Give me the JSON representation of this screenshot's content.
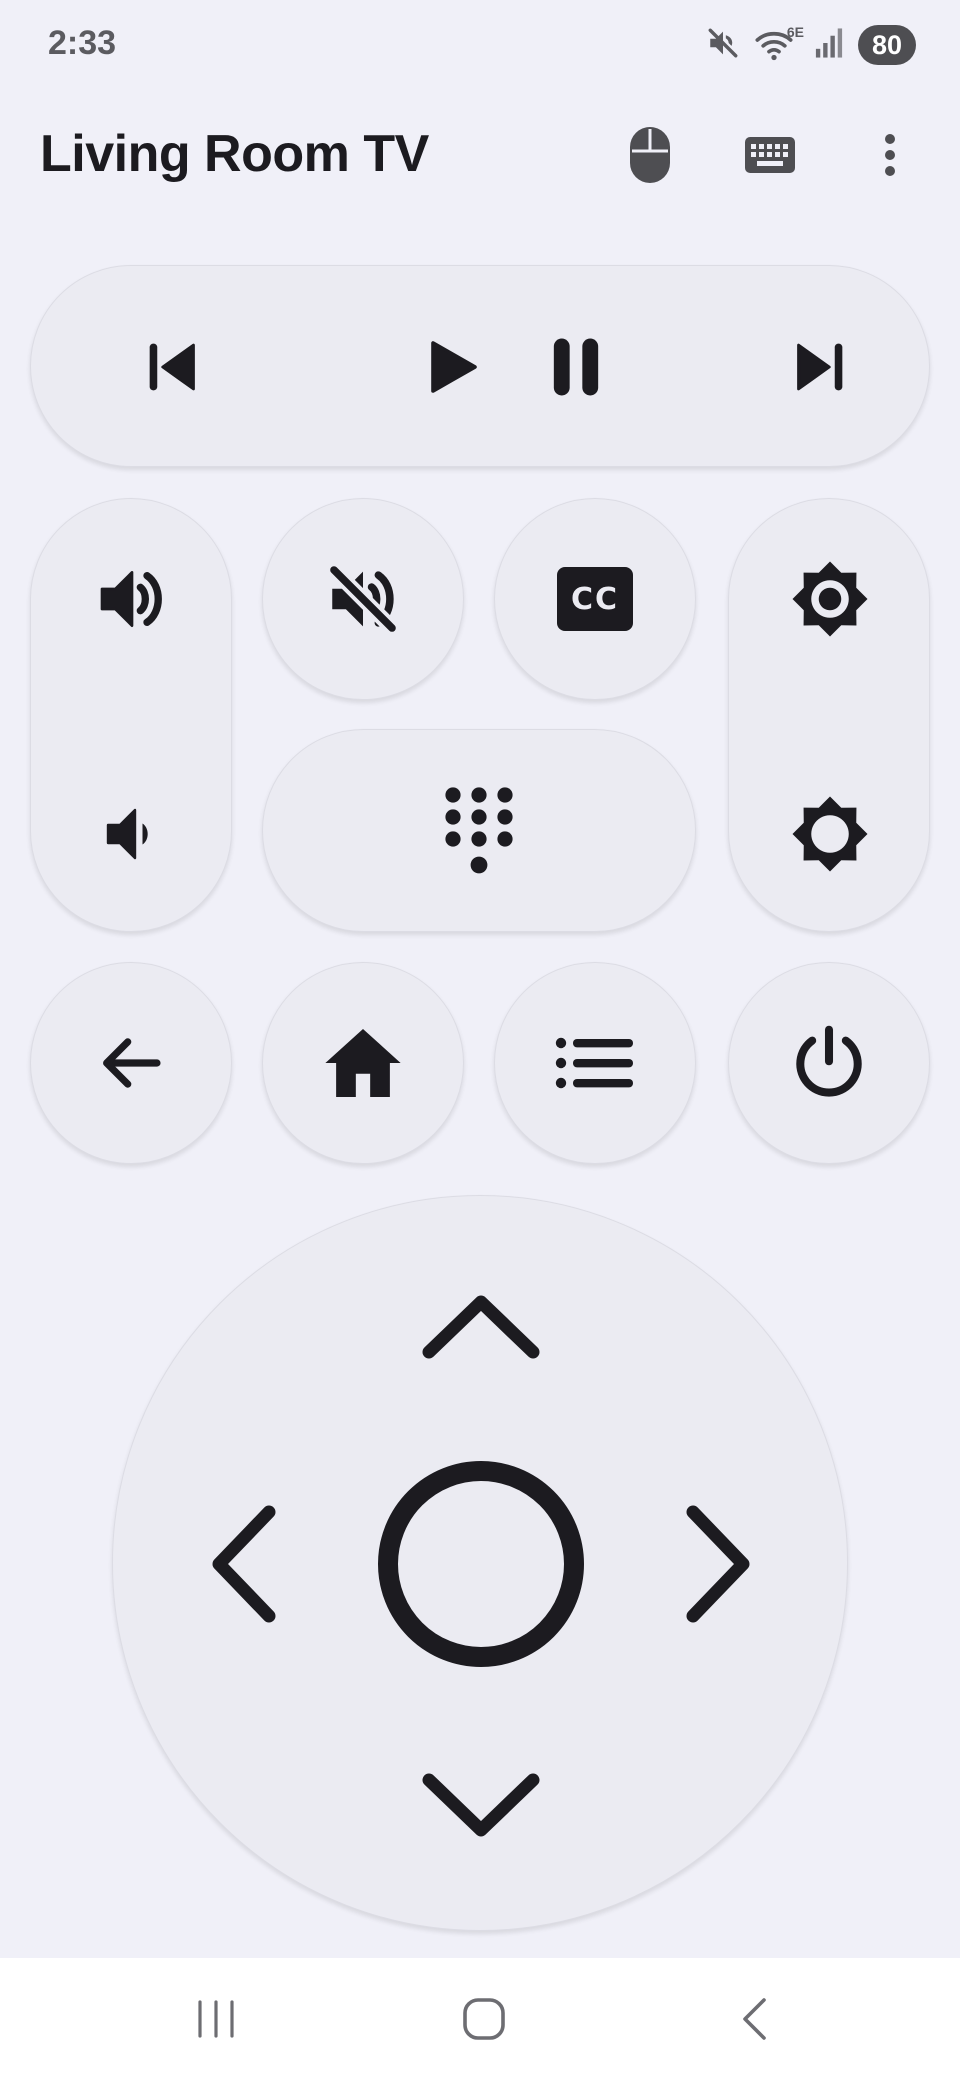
{
  "status_bar": {
    "time": "2:33",
    "battery_level": "80",
    "network_label": "6E",
    "icons": [
      "mute-icon",
      "wifi-icon",
      "signal-icon",
      "battery-icon"
    ]
  },
  "app_bar": {
    "title": "Living Room TV",
    "actions": [
      "mouse-icon",
      "keyboard-icon",
      "more-vert-icon"
    ]
  },
  "remote": {
    "media_row": [
      "skip-previous-icon",
      "play-icon",
      "pause-icon",
      "skip-next-icon"
    ],
    "volume": [
      "volume-up-icon",
      "volume-down-icon"
    ],
    "mute": "volume-off-icon",
    "captions": "closed-caption-icon",
    "captions_label": "CC",
    "numpad": "dialpad-icon",
    "brightness": [
      "brightness-up-icon",
      "brightness-down-icon"
    ],
    "nav_row": [
      "arrow-back-icon",
      "home-icon",
      "list-icon",
      "power-icon"
    ],
    "dpad": [
      "chevron-up-icon",
      "chevron-left-icon",
      "ok-circle-icon",
      "chevron-right-icon",
      "chevron-down-icon"
    ]
  },
  "system_nav": [
    "recents-icon",
    "home-outline-icon",
    "back-chevron-icon"
  ],
  "colors": {
    "background": "#f0f0f8",
    "button": "#ebebf2",
    "icon": "#1c1b20",
    "nav_bar": "#ffffff"
  }
}
